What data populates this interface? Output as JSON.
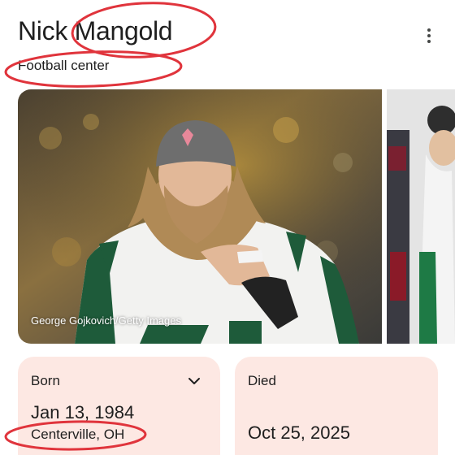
{
  "header": {
    "title": "Nick Mangold",
    "subtitle": "Football center"
  },
  "icons": {
    "menu": "more-vertical-icon",
    "expand": "chevron-down-icon"
  },
  "photos": {
    "credit": "George Gojkovich/Getty Images"
  },
  "facts": {
    "born": {
      "label": "Born",
      "date": "Jan 13, 1984",
      "place": "Centerville, OH"
    },
    "died": {
      "label": "Died",
      "date": "Oct 25, 2025"
    }
  },
  "colors": {
    "card_background": "#fde8e3",
    "annotation_red": "#e0343c",
    "jersey_green": "#1e5b3a"
  }
}
